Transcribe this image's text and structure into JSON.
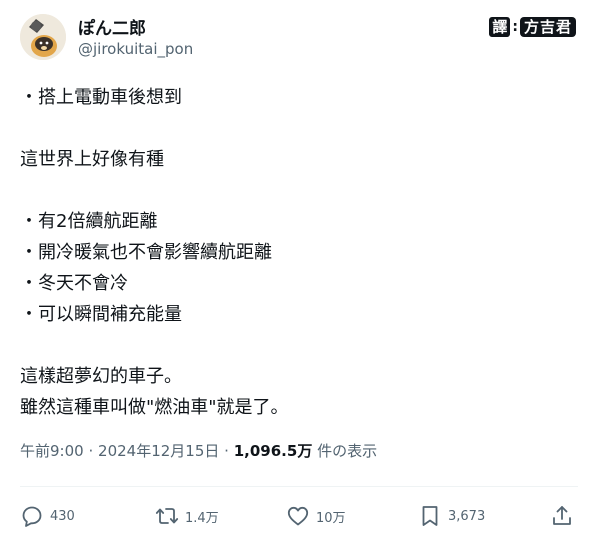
{
  "author": {
    "display_name": "ぽん二郎",
    "handle": "@jirokuitai_pon"
  },
  "badge": {
    "left": "譯",
    "separator": ":",
    "right": "方吉君"
  },
  "tweet_lines": [
    "・搭上電動車後想到",
    "",
    "這世界上好像有種",
    "",
    "・有2倍續航距離",
    "・開冷暖氣也不會影響續航距離",
    "・冬天不會冷",
    "・可以瞬間補充能量",
    "",
    "這樣超夢幻的車子。",
    "雖然這種車叫做\"燃油車\"就是了。"
  ],
  "meta": {
    "time": "午前9:00",
    "separator1": "·",
    "date": "2024年12月15日",
    "separator2": "·",
    "views": "1,096.5万",
    "views_label": "件の表示"
  },
  "actions": {
    "reply_count": "430",
    "retweet_count": "1.4万",
    "like_count": "10万",
    "bookmark_count": "3,673"
  },
  "colors": {
    "text": "#0f1419",
    "secondary": "#536471",
    "divider": "#eff3f4"
  },
  "icons": [
    "reply-icon",
    "retweet-icon",
    "like-icon",
    "bookmark-icon",
    "share-icon"
  ]
}
